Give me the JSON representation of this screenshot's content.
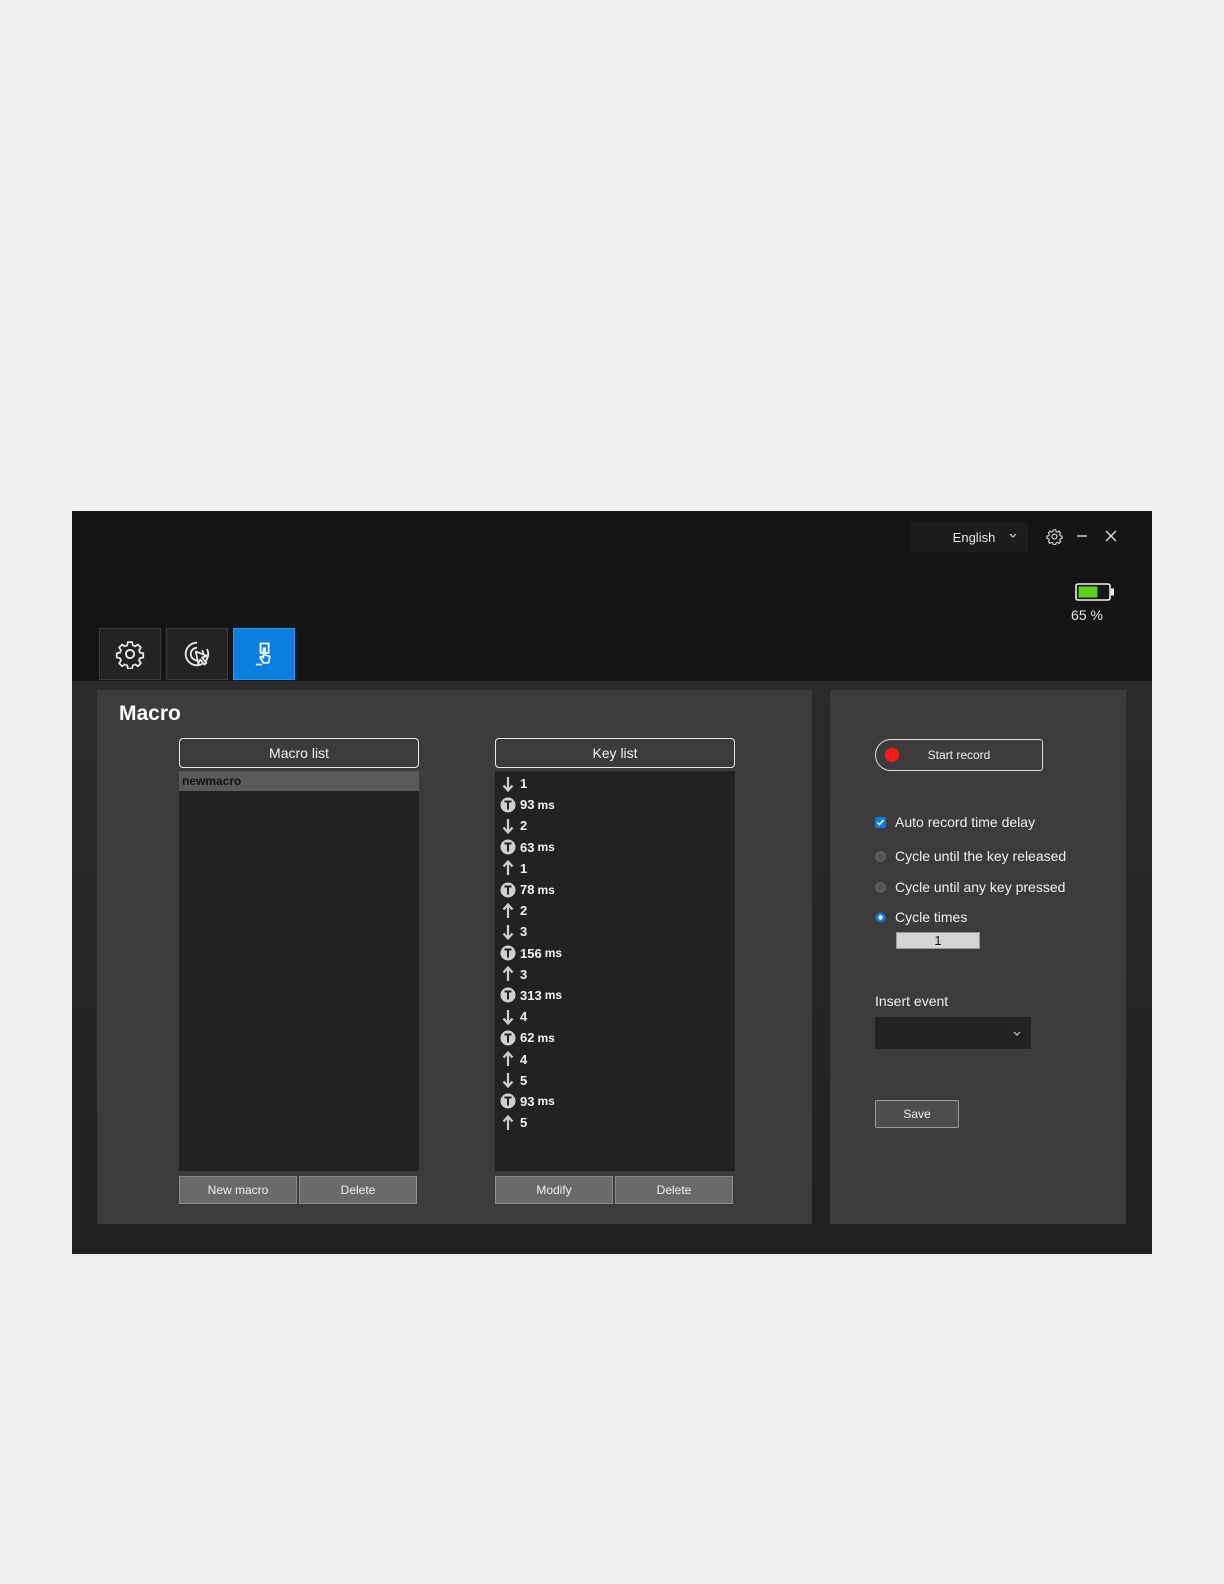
{
  "titlebar": {
    "language": "English",
    "battery_percent": 65,
    "battery_text": "65 %"
  },
  "tabs": [
    {
      "icon": "gear-icon",
      "active": false
    },
    {
      "icon": "mouse-click-icon",
      "active": false
    },
    {
      "icon": "macro-touch-icon",
      "active": true
    }
  ],
  "macro_panel": {
    "title": "Macro",
    "macro_list": {
      "header": "Macro list",
      "items": [
        "newmacro"
      ],
      "new_button": "New macro",
      "delete_button": "Delete"
    },
    "key_list": {
      "header": "Key list",
      "items": [
        {
          "type": "down",
          "value": "1"
        },
        {
          "type": "delay",
          "value": "93",
          "unit": "ms"
        },
        {
          "type": "down",
          "value": "2"
        },
        {
          "type": "delay",
          "value": "63",
          "unit": "ms"
        },
        {
          "type": "up",
          "value": "1"
        },
        {
          "type": "delay",
          "value": "78",
          "unit": "ms"
        },
        {
          "type": "up",
          "value": "2"
        },
        {
          "type": "down",
          "value": "3"
        },
        {
          "type": "delay",
          "value": "156",
          "unit": "ms"
        },
        {
          "type": "up",
          "value": "3"
        },
        {
          "type": "delay",
          "value": "313",
          "unit": "ms"
        },
        {
          "type": "down",
          "value": "4"
        },
        {
          "type": "delay",
          "value": "62",
          "unit": "ms"
        },
        {
          "type": "up",
          "value": "4"
        },
        {
          "type": "down",
          "value": "5"
        },
        {
          "type": "delay",
          "value": "93",
          "unit": "ms"
        },
        {
          "type": "up",
          "value": "5"
        }
      ],
      "modify_button": "Modify",
      "delete_button": "Delete"
    }
  },
  "record_panel": {
    "start_record": "Start record",
    "auto_record_label": "Auto record time delay",
    "auto_record_checked": true,
    "options": [
      {
        "label": "Cycle until the key released",
        "selected": false
      },
      {
        "label": "Cycle until any key pressed",
        "selected": false
      },
      {
        "label": "Cycle times",
        "selected": true
      }
    ],
    "cycle_times_value": "1",
    "insert_event_label": "Insert event",
    "insert_event_value": "",
    "save_button": "Save"
  },
  "colors": {
    "accent": "#0a7de0",
    "record_dot": "#ff1a1a",
    "battery_fill": "#5ad312",
    "background": "#151515",
    "panel": "#3c3c3c"
  }
}
